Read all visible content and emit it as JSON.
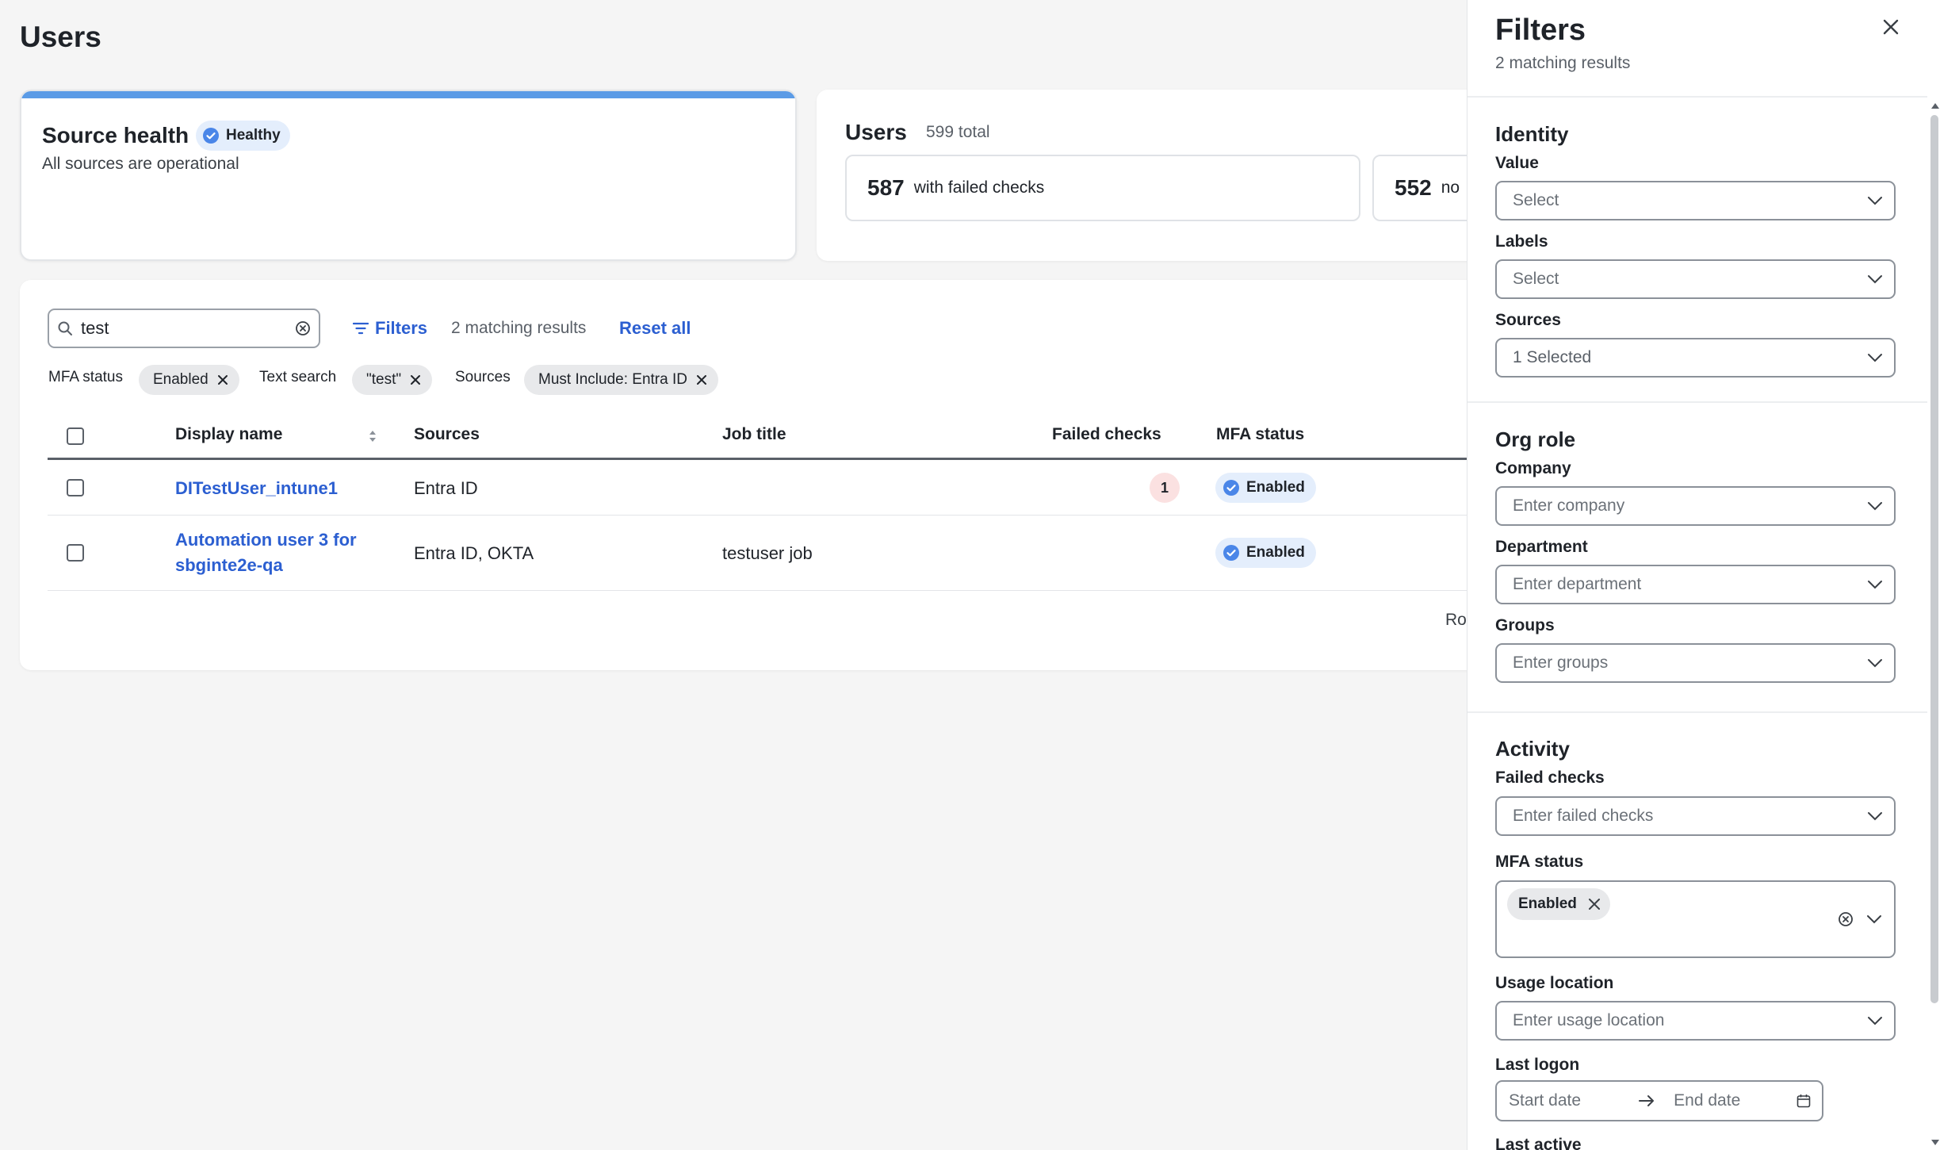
{
  "page": {
    "title": "Users"
  },
  "source_health": {
    "title": "Source health",
    "badge": "Healthy",
    "subtitle": "All sources are operational",
    "accent_color": "#5b9be6"
  },
  "users_summary": {
    "title": "Users",
    "total": "599 total",
    "stats": [
      {
        "value": "587",
        "label": "with failed checks"
      },
      {
        "value": "552",
        "label": "no"
      }
    ]
  },
  "toolbar": {
    "search_value": "test",
    "filters_label": "Filters",
    "matching": "2 matching results",
    "reset_label": "Reset all"
  },
  "active_filters": [
    {
      "label": "MFA status",
      "chip": "Enabled"
    },
    {
      "label": "Text search",
      "chip": "\"test\""
    },
    {
      "label": "Sources",
      "chip": "Must Include: Entra ID"
    }
  ],
  "table": {
    "columns": [
      "Display name",
      "Sources",
      "Job title",
      "Failed checks",
      "MFA status"
    ],
    "rows": [
      {
        "name": "DITestUser_intune1",
        "sources": "Entra ID",
        "job": "",
        "failed": "1",
        "mfa": "Enabled"
      },
      {
        "name_line1": "Automation user 3 for",
        "name_line2": "sbginte2e-qa",
        "sources": "Entra ID, OKTA",
        "job": "testuser job",
        "failed": "",
        "mfa": "Enabled"
      }
    ],
    "rows_per_page_partial": "Ro"
  },
  "filters_panel": {
    "title": "Filters",
    "subtitle": "2 matching results",
    "identity": {
      "title": "Identity",
      "value_label": "Value",
      "value_placeholder": "Select",
      "labels_label": "Labels",
      "labels_placeholder": "Select",
      "sources_label": "Sources",
      "sources_value": "1 Selected"
    },
    "org_role": {
      "title": "Org role",
      "company_label": "Company",
      "company_placeholder": "Enter company",
      "department_label": "Department",
      "department_placeholder": "Enter department",
      "groups_label": "Groups",
      "groups_placeholder": "Enter groups"
    },
    "activity": {
      "title": "Activity",
      "failed_label": "Failed checks",
      "failed_placeholder": "Enter failed checks",
      "mfa_label": "MFA status",
      "mfa_chip": "Enabled",
      "usage_label": "Usage location",
      "usage_placeholder": "Enter usage location",
      "last_logon_label": "Last logon",
      "start_placeholder": "Start date",
      "end_placeholder": "End date",
      "last_active_label": "Last active"
    }
  },
  "colors": {
    "link": "#2c5fd1",
    "badge_blue": "#e4eefc",
    "badge_red": "#fbe1e1",
    "check_blue": "#4a86e8"
  }
}
